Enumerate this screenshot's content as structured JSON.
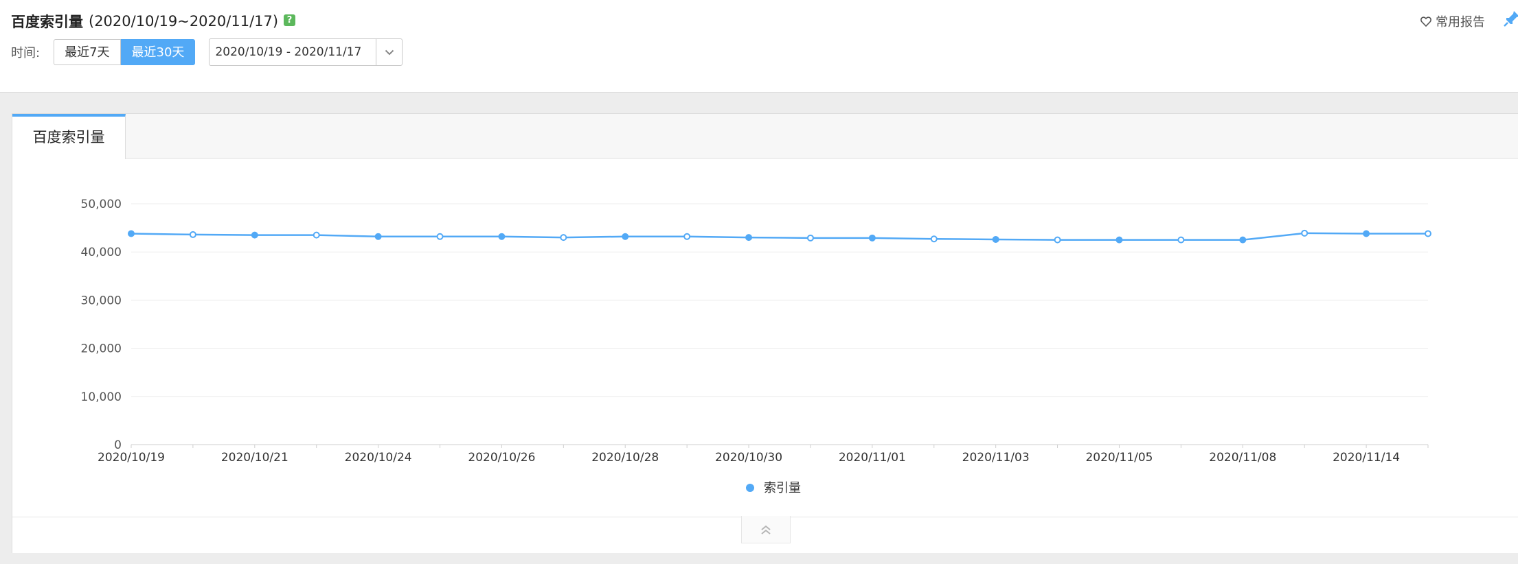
{
  "header": {
    "title": "百度索引量",
    "title_range": "(2020/10/19~2020/11/17)",
    "help_label": "?",
    "favorite_label": "常用报告",
    "time_label": "时间:",
    "range_buttons": [
      "最近7天",
      "最近30天"
    ],
    "active_range": "最近30天",
    "date_range_value": "2020/10/19 - 2020/11/17"
  },
  "tabs": [
    {
      "label": "百度索引量",
      "active": true
    }
  ],
  "colors": {
    "accent": "#52a9f6",
    "help": "#5cb85c"
  },
  "chart_data": {
    "type": "line",
    "title": "",
    "xlabel": "",
    "ylabel": "",
    "ylim": [
      0,
      50000
    ],
    "yticks": [
      "0",
      "10,000",
      "20,000",
      "30,000",
      "40,000",
      "50,000"
    ],
    "ytick_values": [
      0,
      10000,
      20000,
      30000,
      40000,
      50000
    ],
    "x_tick_labels": [
      "2020/10/19",
      "2020/10/21",
      "2020/10/24",
      "2020/10/26",
      "2020/10/28",
      "2020/10/30",
      "2020/11/01",
      "2020/11/03",
      "2020/11/05",
      "2020/11/08",
      "2020/11/14"
    ],
    "grid": true,
    "legend_position": "bottom-center",
    "series": [
      {
        "name": "索引量",
        "color": "#52a9f6",
        "values": [
          43800,
          43600,
          43500,
          43500,
          43200,
          43200,
          43200,
          43000,
          43200,
          43200,
          43000,
          42900,
          42900,
          42700,
          42600,
          42500,
          42500,
          42500,
          42500,
          43900,
          43800,
          43800
        ]
      }
    ]
  }
}
